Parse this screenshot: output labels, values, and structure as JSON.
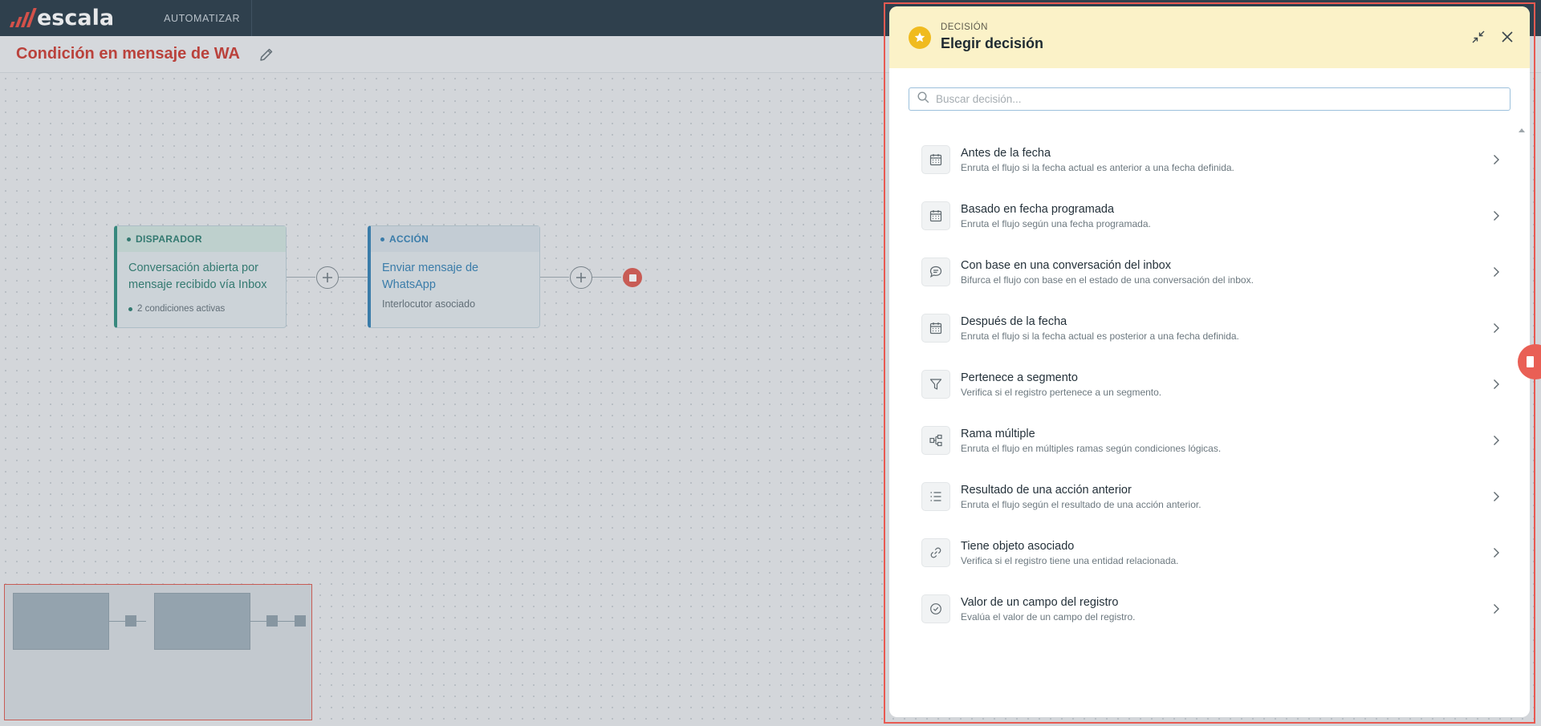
{
  "app": {
    "logo_text": "escala",
    "nav_item": "AUTOMATIZAR"
  },
  "workflow": {
    "title": "Condición en mensaje de WA"
  },
  "canvas": {
    "trigger": {
      "label": "DISPARADOR",
      "title": "Conversación abierta por mensaje recibido vía Inbox",
      "meta": "2 condiciones activas"
    },
    "action": {
      "label": "ACCIÓN",
      "title": "Enviar mensaje de WhatsApp",
      "meta": "Interlocutor asociado"
    }
  },
  "drawer": {
    "eyebrow": "DECISIÓN",
    "title": "Elegir decisión",
    "search_placeholder": "Buscar decisión...",
    "items": [
      {
        "title": "Antes de la fecha",
        "desc": "Enruta el flujo si la fecha actual es anterior a una fecha definida.",
        "icon": "calendar-icon"
      },
      {
        "title": "Basado en fecha programada",
        "desc": "Enruta el flujo según una fecha programada.",
        "icon": "calendar-icon"
      },
      {
        "title": "Con base en una conversación del inbox",
        "desc": "Bifurca el flujo con base en el estado de una conversación del inbox.",
        "icon": "chat-icon"
      },
      {
        "title": "Después de la fecha",
        "desc": "Enruta el flujo si la fecha actual es posterior a una fecha definida.",
        "icon": "calendar-icon"
      },
      {
        "title": "Pertenece a segmento",
        "desc": "Verifica si el registro pertenece a un segmento.",
        "icon": "filter-icon"
      },
      {
        "title": "Rama múltiple",
        "desc": "Enruta el flujo en múltiples ramas según condiciones lógicas.",
        "icon": "branch-icon"
      },
      {
        "title": "Resultado de una acción anterior",
        "desc": "Enruta el flujo según el resultado de una acción anterior.",
        "icon": "list-icon"
      },
      {
        "title": "Tiene objeto asociado",
        "desc": "Verifica si el registro tiene una entidad relacionada.",
        "icon": "link-icon"
      },
      {
        "title": "Valor de un campo del registro",
        "desc": "Evalúa el valor de un campo del registro.",
        "icon": "check-circle-icon"
      }
    ]
  },
  "colors": {
    "brand": "#e8473c",
    "topbar": "#1f3340",
    "trigger": "#24786b",
    "action": "#2c7cb0",
    "drawer_header": "#fbf2c8",
    "star": "#f0bb1f"
  }
}
